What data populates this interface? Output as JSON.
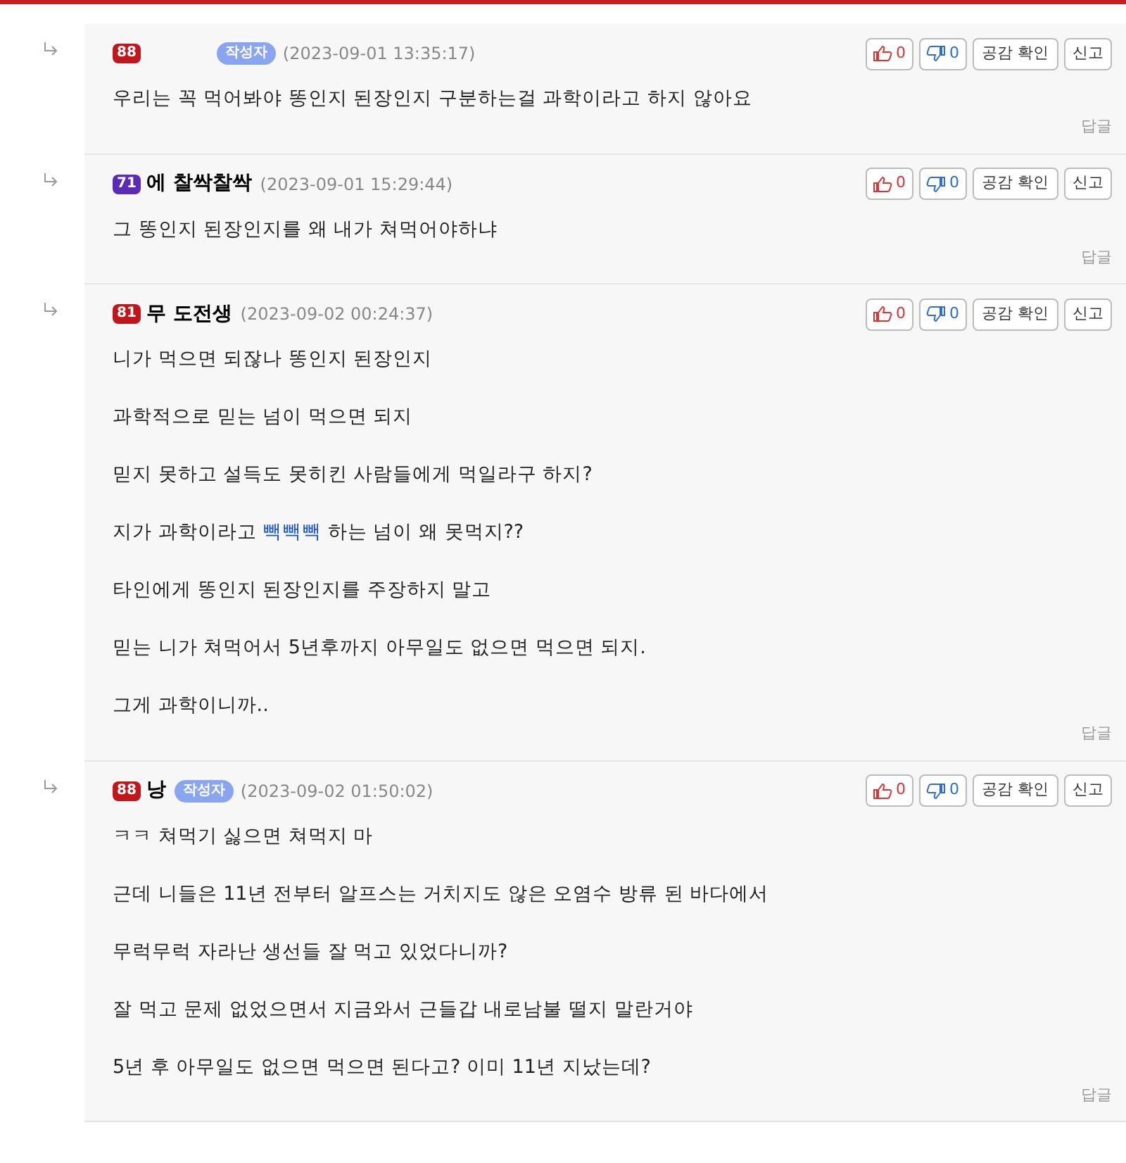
{
  "comments": [
    {
      "level": "88",
      "color": "#c0161c",
      "author_badge": "작성자",
      "time": "(2023-09-01 13:35:17)",
      "likes": "0",
      "dislikes": "0",
      "empathy": "공감 확인",
      "report": "신고",
      "lines": [
        [
          {
            "text": "우리는 꼭 먹어봐야 똥인지 된장인지 구분하는걸 과학이라고 하지 않아요",
            "link": false
          }
        ]
      ],
      "reply": "답글"
    },
    {
      "level": "71",
      "color": "#5b2bb5",
      "name": "에 찰싹찰싹",
      "time": "(2023-09-01 15:29:44)",
      "likes": "0",
      "dislikes": "0",
      "empathy": "공감 확인",
      "report": "신고",
      "lines": [
        [
          {
            "text": "그 똥인지 된장인지를 왜 내가 쳐먹어야하냐",
            "link": false
          }
        ]
      ],
      "reply": "답글"
    },
    {
      "level": "81",
      "color": "#c0161c",
      "name": "무 도전생",
      "time": "(2023-09-02 00:24:37)",
      "likes": "0",
      "dislikes": "0",
      "empathy": "공감 확인",
      "report": "신고",
      "lines": [
        [
          {
            "text": "니가 먹으면 되잖나 똥인지 된장인지",
            "link": false
          }
        ],
        [
          {
            "text": "과학적으로 믿는 넘이 먹으면 되지",
            "link": false
          }
        ],
        [
          {
            "text": "믿지 못하고 설득도 못히킨 사람들에게 먹일라구 하지?",
            "link": false
          }
        ],
        [
          {
            "text": "지가 과학이라고 ",
            "link": false
          },
          {
            "text": "빽빽빽",
            "link": true
          },
          {
            "text": " 하는 넘이 왜 못먹지??",
            "link": false
          }
        ],
        [
          {
            "text": "타인에게 똥인지 된장인지를 주장하지 말고",
            "link": false
          }
        ],
        [
          {
            "text": "믿는 니가 쳐먹어서 5년후까지 아무일도 없으면 먹으면 되지.",
            "link": false
          }
        ],
        [
          {
            "text": "그게 과학이니까..",
            "link": false
          }
        ]
      ],
      "reply": "답글"
    },
    {
      "level": "88",
      "color": "#c0161c",
      "name": "낭",
      "author_badge": "작성자",
      "time": "(2023-09-02 01:50:02)",
      "likes": "0",
      "dislikes": "0",
      "empathy": "공감 확인",
      "report": "신고",
      "lines": [
        [
          {
            "text": "ㅋㅋ 쳐먹기 싫으면 쳐먹지 마",
            "link": false
          }
        ],
        [
          {
            "text": "근데 니들은 11년 전부터 알프스는 거치지도 않은 오염수 방류 된 바다에서",
            "link": false
          }
        ],
        [
          {
            "text": "무럭무럭 자라난 생선들 잘 먹고 있었다니까?",
            "link": false
          }
        ],
        [
          {
            "text": "잘 먹고 문제 없었으면서 지금와서 근들갑 내로남불 떨지 말란거야",
            "link": false
          }
        ],
        [
          {
            "text": "5년 후 아무일도 없으면 먹으면 된다고? 이미 11년 지났는데?",
            "link": false
          }
        ]
      ],
      "reply": "답글"
    }
  ]
}
